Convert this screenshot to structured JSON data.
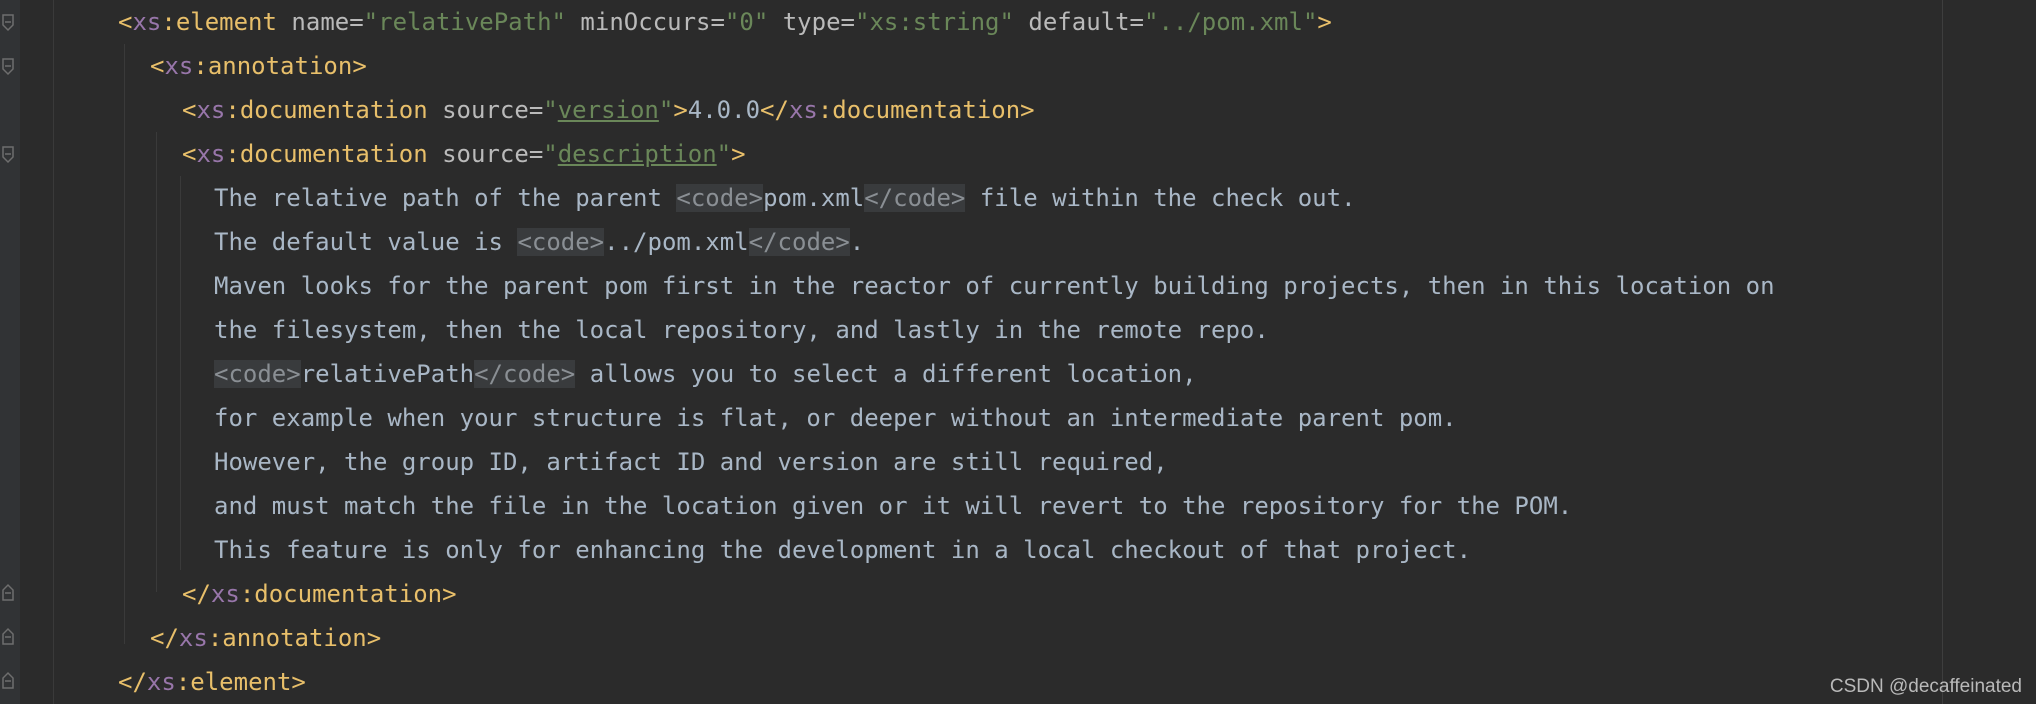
{
  "colors": {
    "background": "#2b2b2b",
    "gutter": "#313335",
    "bracket": "#e8bf6a",
    "namespace": "#9876aa",
    "tag_name": "#e8bf6a",
    "attribute": "#bababa",
    "attribute_value": "#6a8759",
    "text": "#a9b7c6"
  },
  "gutter_icons": [
    "fold-start-icon",
    "fold-start-icon",
    "fold-start-icon",
    "fold-end-icon",
    "fold-end-icon",
    "fold-end-icon"
  ],
  "editor": {
    "element_open": {
      "open_bracket": "<",
      "ns": "xs",
      "colon": ":",
      "tag": "element",
      "attrs": [
        {
          "name": "name",
          "value": "relativePath"
        },
        {
          "name": "minOccurs",
          "value": "0"
        },
        {
          "name": "type",
          "value": "xs:string"
        },
        {
          "name": "default",
          "value": "../pom.xml"
        }
      ],
      "close_bracket": ">"
    },
    "annotation_open": {
      "open_bracket": "<",
      "ns": "xs",
      "colon": ":",
      "tag": "annotation",
      "close_bracket": ">"
    },
    "doc_version": {
      "open_bracket": "<",
      "ns": "xs",
      "colon": ":",
      "tag": "documentation",
      "attr_name": "source",
      "attr_value": "version",
      "close_bracket": ">",
      "text": "4.0.0",
      "end_open": "</",
      "end_ns": "xs",
      "end_colon": ":",
      "end_tag": "documentation",
      "end_close": ">"
    },
    "doc_description": {
      "open_bracket": "<",
      "ns": "xs",
      "colon": ":",
      "tag": "documentation",
      "attr_name": "source",
      "attr_value": "description",
      "close_bracket": ">"
    },
    "description_lines": {
      "l1_text_a": "The relative path of the parent ",
      "l1_code_a": "<code>",
      "l1_mid": "pom.xml",
      "l1_code_b": "</code>",
      "l1_text_b": " file within the check out.",
      "l2_text_a": "The default value is ",
      "l2_code_a": "<code>",
      "l2_mid": "../pom.xml",
      "l2_code_b": "</code>",
      "l2_text_b": ".",
      "l3": "Maven looks for the parent pom first in the reactor of currently building projects, then in this location on",
      "l4": "the filesystem, then the local repository, and lastly in the remote repo.",
      "l5_code_a": "<code>",
      "l5_mid": "relativePath",
      "l5_code_b": "</code>",
      "l5_text": " allows you to select a different location,",
      "l6": "for example when your structure is flat, or deeper without an intermediate parent pom.",
      "l7": "However, the group ID, artifact ID and version are still required,",
      "l8": "and must match the file in the location given or it will revert to the repository for the POM.",
      "l9": "This feature is only for enhancing the development in a local checkout of that project."
    },
    "doc_close": {
      "open_bracket": "</",
      "ns": "xs",
      "colon": ":",
      "tag": "documentation",
      "close_bracket": ">"
    },
    "annotation_close": {
      "open_bracket": "</",
      "ns": "xs",
      "colon": ":",
      "tag": "annotation",
      "close_bracket": ">"
    },
    "element_close": {
      "open_bracket": "</",
      "ns": "xs",
      "colon": ":",
      "tag": "element",
      "close_bracket": ">"
    }
  },
  "watermark": "CSDN @decaffeinated"
}
